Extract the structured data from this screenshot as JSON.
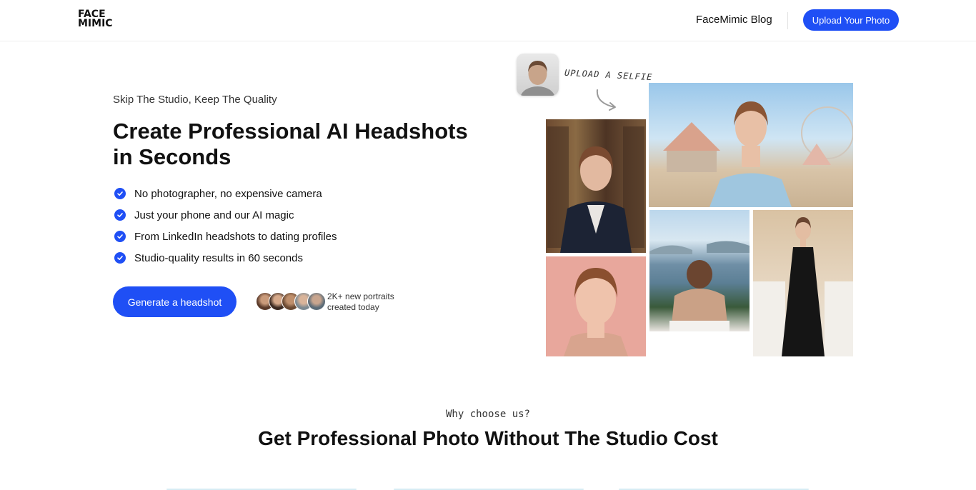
{
  "header": {
    "logo_line1": "FACE",
    "logo_line2": "MIMIC",
    "blog_link": "FaceMimic Blog",
    "upload_button": "Upload Your Photo"
  },
  "hero": {
    "tagline": "Skip The Studio, Keep The Quality",
    "headline": "Create Professional AI Headshots in Seconds",
    "features": [
      "No photographer, no expensive camera",
      "Just your phone and our AI magic",
      "From LinkedIn headshots to dating profiles",
      "Studio-quality results in 60 seconds"
    ],
    "cta_button": "Generate a headshot",
    "portraits_line1": "2K+ new portraits",
    "portraits_line2": "created today",
    "selfie_label": "UPLOAD A SELFIE"
  },
  "section": {
    "eyebrow": "Why choose us?",
    "title": "Get Professional Photo Without The Studio Cost"
  },
  "colors": {
    "accent": "#1f4ff5"
  }
}
